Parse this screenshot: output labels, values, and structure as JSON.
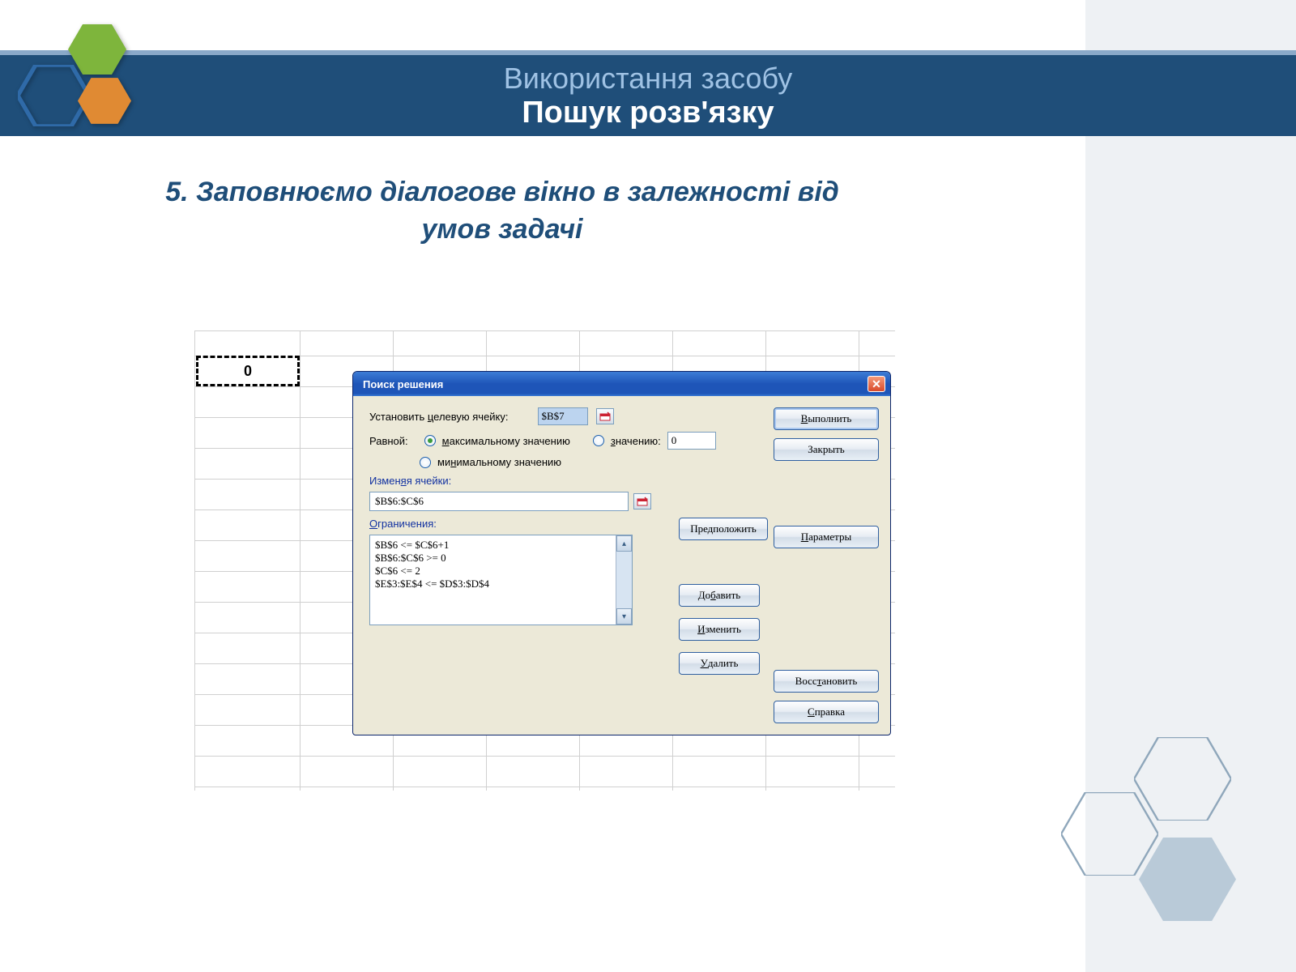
{
  "slide": {
    "title_line1": "Використання засобу",
    "title_line2": "Пошук розв'язку",
    "subtitle": "5. Заповнюємо діалогове вікно в залежності від умов задачі"
  },
  "cell_value": "0",
  "dialog": {
    "title": "Поиск решения",
    "target_label": "Установить целевую ячейку:",
    "target_value": "$B$7",
    "equal_label": "Равной:",
    "opt_max": "максимальному значению",
    "opt_val": "значению:",
    "opt_min": "минимальному значению",
    "val_input": "0",
    "change_label": "Изменяя ячейки:",
    "change_value": "$B$6:$C$6",
    "constraints_label": "Ограничения:",
    "constraints": [
      "$B$6 <= $C$6+1",
      "$B$6:$C$6 >= 0",
      "$C$6 <= 2",
      "$E$3:$E$4 <= $D$3:$D$4"
    ],
    "btn_guess": "Предположить",
    "btn_add": "Добавить",
    "btn_edit": "Изменить",
    "btn_delete": "Удалить",
    "btn_run": "Выполнить",
    "btn_close": "Закрыть",
    "btn_params": "Параметры",
    "btn_reset": "Восстановить",
    "btn_help": "Справка"
  },
  "colors": {
    "band": "#1f4e79",
    "accent_light": "#9fc2e4"
  }
}
